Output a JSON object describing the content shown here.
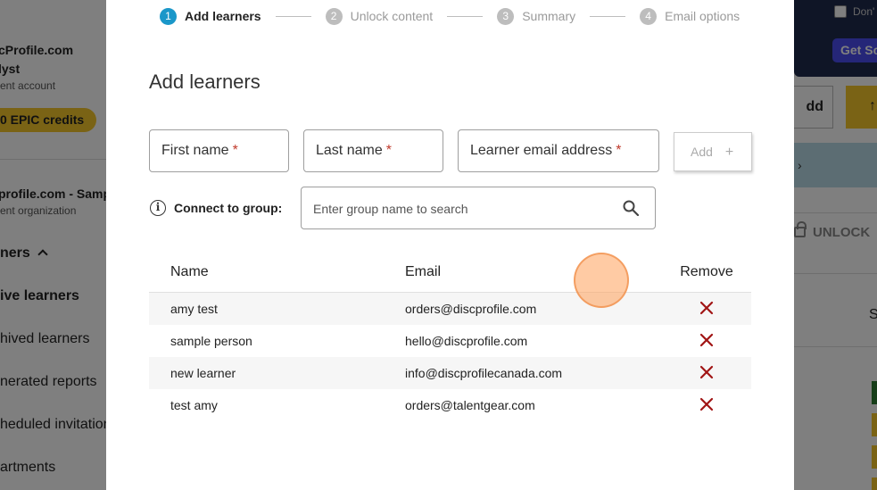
{
  "background": {
    "sidebar": {
      "brand": "cProfile.com",
      "role": "lyst",
      "account": "ent account",
      "credits": "0 EPIC credits",
      "org": "profile.com - Samp",
      "org_sub": "ent organization",
      "nav": [
        {
          "label": "ners",
          "bold": true
        },
        {
          "label": "ive learners",
          "bold": true
        },
        {
          "label": "hived learners",
          "bold": false
        },
        {
          "label": "nerated reports",
          "bold": false
        },
        {
          "label": "heduled invitation",
          "bold": false
        },
        {
          "label": "artments",
          "bold": false
        }
      ]
    },
    "right": {
      "dont_label": "Don'",
      "get_label": "Get Sc",
      "add_label": "dd",
      "unlock_label": "UNLOCK",
      "s_label": "S"
    }
  },
  "modal": {
    "steps": [
      {
        "num": "1",
        "label": "Add learners",
        "active": true
      },
      {
        "num": "2",
        "label": "Unlock content",
        "active": false
      },
      {
        "num": "3",
        "label": "Summary",
        "active": false
      },
      {
        "num": "4",
        "label": "Email options",
        "active": false
      }
    ],
    "title": "Add learners",
    "fields": {
      "first_name": "First name",
      "last_name": "Last name",
      "email": "Learner email address",
      "required_mark": "*"
    },
    "add_button": "Add",
    "add_plus": "+",
    "group": {
      "label": "Connect to group:",
      "placeholder": "Enter group name to search"
    },
    "table": {
      "headers": {
        "name": "Name",
        "email": "Email",
        "remove": "Remove"
      },
      "rows": [
        {
          "name": "amy test",
          "email": "orders@discprofile.com"
        },
        {
          "name": "sample person",
          "email": "hello@discprofile.com"
        },
        {
          "name": "new learner",
          "email": "info@discprofilecanada.com"
        },
        {
          "name": "test amy",
          "email": "orders@talentgear.com"
        }
      ]
    },
    "colors": {
      "accent": "#1a97c9",
      "remove": "#a11515",
      "required": "#c0392b"
    }
  }
}
